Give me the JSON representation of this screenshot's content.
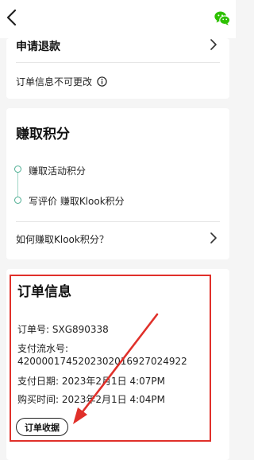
{
  "header": {
    "back_icon": "chevron-left-icon",
    "wechat_icon": "wechat-icon",
    "wechat_color": "#2dc100"
  },
  "refund_card": {
    "apply_refund_label": "申请退款",
    "info_unchangeable_label": "订单信息不可更改"
  },
  "points_card": {
    "title": "赚取积分",
    "steps": [
      {
        "label": "赚取活动积分"
      },
      {
        "label": "写评价 赚取Klook积分"
      }
    ],
    "how_to_label": "如何赚取Klook积分？",
    "step_color": "#4fae93"
  },
  "order_card": {
    "title": "订单信息",
    "order_no": "订单号: SXG890338",
    "txn_label": "支付流水号:",
    "txn_value": "4200001745202302016927024922",
    "pay_date": "支付日期: 2023年2月1日 4:07PM",
    "purchase_time": "购买时间: 2023年2月1日 4:04PM",
    "receipt_button_label": "订单收据"
  },
  "annotation": {
    "highlight_color": "#e0302a"
  }
}
